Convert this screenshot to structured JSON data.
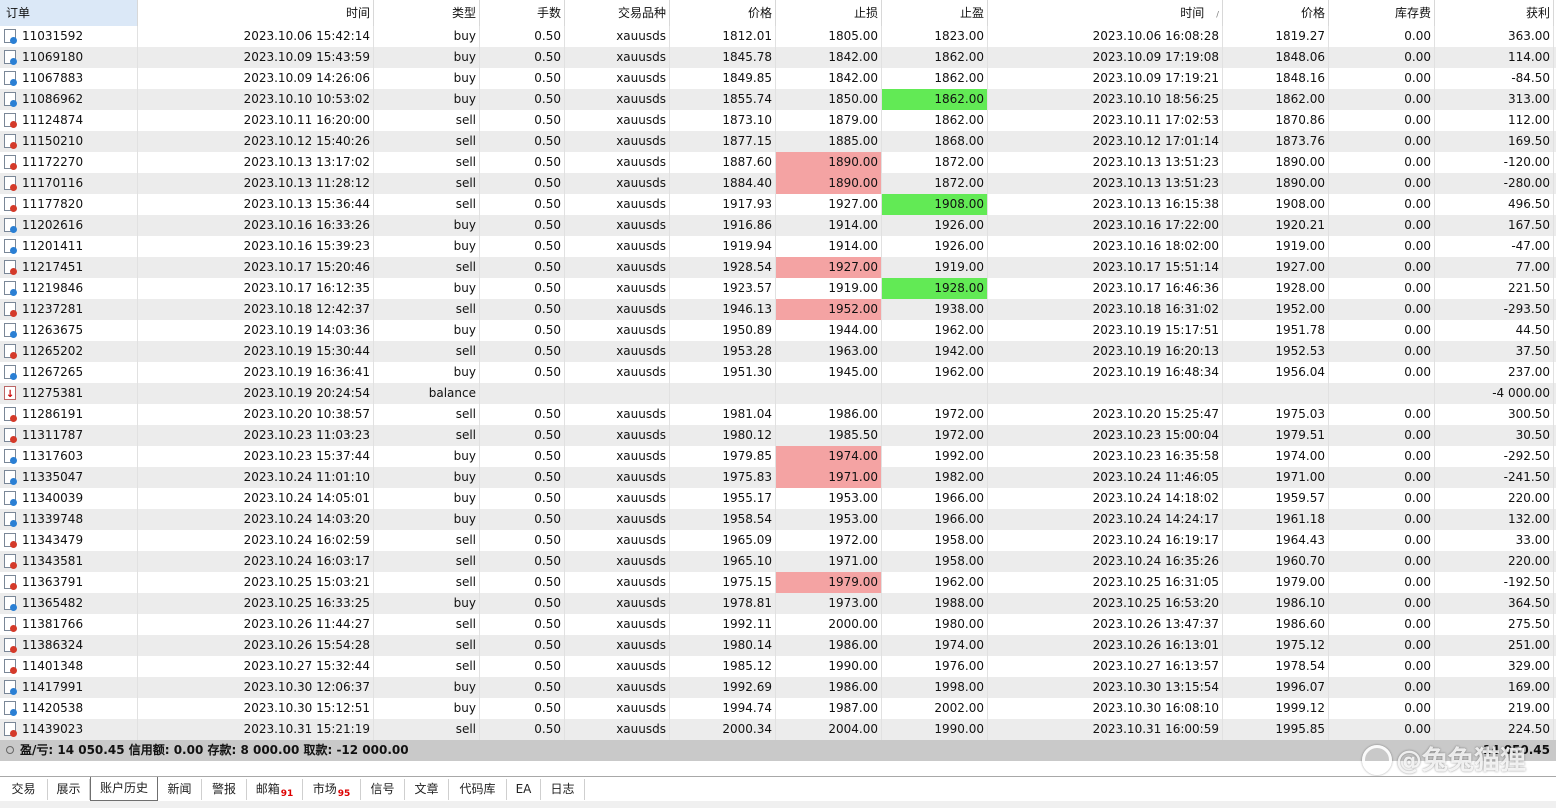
{
  "columns": [
    "订单",
    "时间",
    "类型",
    "手数",
    "交易品种",
    "价格",
    "止损",
    "止盈",
    "时间",
    "价格",
    "库存费",
    "获利"
  ],
  "sort_indicator": "/",
  "colors": {
    "sl_hit": "#f4a3a3",
    "tp_hit": "#62ea55",
    "buy_icon": "#2a7fd4",
    "sell_icon": "#d43a2a"
  },
  "rows": [
    {
      "order": "11031592",
      "open_time": "2023.10.06 15:42:14",
      "type": "buy",
      "lots": "0.50",
      "symbol": "xauusds",
      "price": "1812.01",
      "sl": "1805.00",
      "tp": "1823.00",
      "close_time": "2023.10.06 16:08:28",
      "close_price": "1819.27",
      "swap": "0.00",
      "profit": "363.00",
      "hl": ""
    },
    {
      "order": "11069180",
      "open_time": "2023.10.09 15:43:59",
      "type": "buy",
      "lots": "0.50",
      "symbol": "xauusds",
      "price": "1845.78",
      "sl": "1842.00",
      "tp": "1862.00",
      "close_time": "2023.10.09 17:19:08",
      "close_price": "1848.06",
      "swap": "0.00",
      "profit": "114.00",
      "hl": ""
    },
    {
      "order": "11067883",
      "open_time": "2023.10.09 14:26:06",
      "type": "buy",
      "lots": "0.50",
      "symbol": "xauusds",
      "price": "1849.85",
      "sl": "1842.00",
      "tp": "1862.00",
      "close_time": "2023.10.09 17:19:21",
      "close_price": "1848.16",
      "swap": "0.00",
      "profit": "-84.50",
      "hl": ""
    },
    {
      "order": "11086962",
      "open_time": "2023.10.10 10:53:02",
      "type": "buy",
      "lots": "0.50",
      "symbol": "xauusds",
      "price": "1855.74",
      "sl": "1850.00",
      "tp": "1862.00",
      "close_time": "2023.10.10 18:56:25",
      "close_price": "1862.00",
      "swap": "0.00",
      "profit": "313.00",
      "hl": "tp"
    },
    {
      "order": "11124874",
      "open_time": "2023.10.11 16:20:00",
      "type": "sell",
      "lots": "0.50",
      "symbol": "xauusds",
      "price": "1873.10",
      "sl": "1879.00",
      "tp": "1862.00",
      "close_time": "2023.10.11 17:02:53",
      "close_price": "1870.86",
      "swap": "0.00",
      "profit": "112.00",
      "hl": ""
    },
    {
      "order": "11150210",
      "open_time": "2023.10.12 15:40:26",
      "type": "sell",
      "lots": "0.50",
      "symbol": "xauusds",
      "price": "1877.15",
      "sl": "1885.00",
      "tp": "1868.00",
      "close_time": "2023.10.12 17:01:14",
      "close_price": "1873.76",
      "swap": "0.00",
      "profit": "169.50",
      "hl": ""
    },
    {
      "order": "11172270",
      "open_time": "2023.10.13 13:17:02",
      "type": "sell",
      "lots": "0.50",
      "symbol": "xauusds",
      "price": "1887.60",
      "sl": "1890.00",
      "tp": "1872.00",
      "close_time": "2023.10.13 13:51:23",
      "close_price": "1890.00",
      "swap": "0.00",
      "profit": "-120.00",
      "hl": "sl"
    },
    {
      "order": "11170116",
      "open_time": "2023.10.13 11:28:12",
      "type": "sell",
      "lots": "0.50",
      "symbol": "xauusds",
      "price": "1884.40",
      "sl": "1890.00",
      "tp": "1872.00",
      "close_time": "2023.10.13 13:51:23",
      "close_price": "1890.00",
      "swap": "0.00",
      "profit": "-280.00",
      "hl": "sl"
    },
    {
      "order": "11177820",
      "open_time": "2023.10.13 15:36:44",
      "type": "sell",
      "lots": "0.50",
      "symbol": "xauusds",
      "price": "1917.93",
      "sl": "1927.00",
      "tp": "1908.00",
      "close_time": "2023.10.13 16:15:38",
      "close_price": "1908.00",
      "swap": "0.00",
      "profit": "496.50",
      "hl": "tp"
    },
    {
      "order": "11202616",
      "open_time": "2023.10.16 16:33:26",
      "type": "buy",
      "lots": "0.50",
      "symbol": "xauusds",
      "price": "1916.86",
      "sl": "1914.00",
      "tp": "1926.00",
      "close_time": "2023.10.16 17:22:00",
      "close_price": "1920.21",
      "swap": "0.00",
      "profit": "167.50",
      "hl": ""
    },
    {
      "order": "11201411",
      "open_time": "2023.10.16 15:39:23",
      "type": "buy",
      "lots": "0.50",
      "symbol": "xauusds",
      "price": "1919.94",
      "sl": "1914.00",
      "tp": "1926.00",
      "close_time": "2023.10.16 18:02:00",
      "close_price": "1919.00",
      "swap": "0.00",
      "profit": "-47.00",
      "hl": ""
    },
    {
      "order": "11217451",
      "open_time": "2023.10.17 15:20:46",
      "type": "sell",
      "lots": "0.50",
      "symbol": "xauusds",
      "price": "1928.54",
      "sl": "1927.00",
      "tp": "1919.00",
      "close_time": "2023.10.17 15:51:14",
      "close_price": "1927.00",
      "swap": "0.00",
      "profit": "77.00",
      "hl": "sl"
    },
    {
      "order": "11219846",
      "open_time": "2023.10.17 16:12:35",
      "type": "buy",
      "lots": "0.50",
      "symbol": "xauusds",
      "price": "1923.57",
      "sl": "1919.00",
      "tp": "1928.00",
      "close_time": "2023.10.17 16:46:36",
      "close_price": "1928.00",
      "swap": "0.00",
      "profit": "221.50",
      "hl": "tp"
    },
    {
      "order": "11237281",
      "open_time": "2023.10.18 12:42:37",
      "type": "sell",
      "lots": "0.50",
      "symbol": "xauusds",
      "price": "1946.13",
      "sl": "1952.00",
      "tp": "1938.00",
      "close_time": "2023.10.18 16:31:02",
      "close_price": "1952.00",
      "swap": "0.00",
      "profit": "-293.50",
      "hl": "sl"
    },
    {
      "order": "11263675",
      "open_time": "2023.10.19 14:03:36",
      "type": "buy",
      "lots": "0.50",
      "symbol": "xauusds",
      "price": "1950.89",
      "sl": "1944.00",
      "tp": "1962.00",
      "close_time": "2023.10.19 15:17:51",
      "close_price": "1951.78",
      "swap": "0.00",
      "profit": "44.50",
      "hl": ""
    },
    {
      "order": "11265202",
      "open_time": "2023.10.19 15:30:44",
      "type": "sell",
      "lots": "0.50",
      "symbol": "xauusds",
      "price": "1953.28",
      "sl": "1963.00",
      "tp": "1942.00",
      "close_time": "2023.10.19 16:20:13",
      "close_price": "1952.53",
      "swap": "0.00",
      "profit": "37.50",
      "hl": ""
    },
    {
      "order": "11267265",
      "open_time": "2023.10.19 16:36:41",
      "type": "buy",
      "lots": "0.50",
      "symbol": "xauusds",
      "price": "1951.30",
      "sl": "1945.00",
      "tp": "1962.00",
      "close_time": "2023.10.19 16:48:34",
      "close_price": "1956.04",
      "swap": "0.00",
      "profit": "237.00",
      "hl": ""
    },
    {
      "order": "11275381",
      "open_time": "2023.10.19 20:24:54",
      "type": "balance",
      "lots": "",
      "symbol": "",
      "price": "",
      "sl": "",
      "tp": "",
      "close_time": "",
      "close_price": "",
      "swap": "",
      "profit": "-4 000.00",
      "hl": ""
    },
    {
      "order": "11286191",
      "open_time": "2023.10.20 10:38:57",
      "type": "sell",
      "lots": "0.50",
      "symbol": "xauusds",
      "price": "1981.04",
      "sl": "1986.00",
      "tp": "1972.00",
      "close_time": "2023.10.20 15:25:47",
      "close_price": "1975.03",
      "swap": "0.00",
      "profit": "300.50",
      "hl": ""
    },
    {
      "order": "11311787",
      "open_time": "2023.10.23 11:03:23",
      "type": "sell",
      "lots": "0.50",
      "symbol": "xauusds",
      "price": "1980.12",
      "sl": "1985.50",
      "tp": "1972.00",
      "close_time": "2023.10.23 15:00:04",
      "close_price": "1979.51",
      "swap": "0.00",
      "profit": "30.50",
      "hl": ""
    },
    {
      "order": "11317603",
      "open_time": "2023.10.23 15:37:44",
      "type": "buy",
      "lots": "0.50",
      "symbol": "xauusds",
      "price": "1979.85",
      "sl": "1974.00",
      "tp": "1992.00",
      "close_time": "2023.10.23 16:35:58",
      "close_price": "1974.00",
      "swap": "0.00",
      "profit": "-292.50",
      "hl": "sl"
    },
    {
      "order": "11335047",
      "open_time": "2023.10.24 11:01:10",
      "type": "buy",
      "lots": "0.50",
      "symbol": "xauusds",
      "price": "1975.83",
      "sl": "1971.00",
      "tp": "1982.00",
      "close_time": "2023.10.24 11:46:05",
      "close_price": "1971.00",
      "swap": "0.00",
      "profit": "-241.50",
      "hl": "sl"
    },
    {
      "order": "11340039",
      "open_time": "2023.10.24 14:05:01",
      "type": "buy",
      "lots": "0.50",
      "symbol": "xauusds",
      "price": "1955.17",
      "sl": "1953.00",
      "tp": "1966.00",
      "close_time": "2023.10.24 14:18:02",
      "close_price": "1959.57",
      "swap": "0.00",
      "profit": "220.00",
      "hl": ""
    },
    {
      "order": "11339748",
      "open_time": "2023.10.24 14:03:20",
      "type": "buy",
      "lots": "0.50",
      "symbol": "xauusds",
      "price": "1958.54",
      "sl": "1953.00",
      "tp": "1966.00",
      "close_time": "2023.10.24 14:24:17",
      "close_price": "1961.18",
      "swap": "0.00",
      "profit": "132.00",
      "hl": ""
    },
    {
      "order": "11343479",
      "open_time": "2023.10.24 16:02:59",
      "type": "sell",
      "lots": "0.50",
      "symbol": "xauusds",
      "price": "1965.09",
      "sl": "1972.00",
      "tp": "1958.00",
      "close_time": "2023.10.24 16:19:17",
      "close_price": "1964.43",
      "swap": "0.00",
      "profit": "33.00",
      "hl": ""
    },
    {
      "order": "11343581",
      "open_time": "2023.10.24 16:03:17",
      "type": "sell",
      "lots": "0.50",
      "symbol": "xauusds",
      "price": "1965.10",
      "sl": "1971.00",
      "tp": "1958.00",
      "close_time": "2023.10.24 16:35:26",
      "close_price": "1960.70",
      "swap": "0.00",
      "profit": "220.00",
      "hl": ""
    },
    {
      "order": "11363791",
      "open_time": "2023.10.25 15:03:21",
      "type": "sell",
      "lots": "0.50",
      "symbol": "xauusds",
      "price": "1975.15",
      "sl": "1979.00",
      "tp": "1962.00",
      "close_time": "2023.10.25 16:31:05",
      "close_price": "1979.00",
      "swap": "0.00",
      "profit": "-192.50",
      "hl": "sl"
    },
    {
      "order": "11365482",
      "open_time": "2023.10.25 16:33:25",
      "type": "buy",
      "lots": "0.50",
      "symbol": "xauusds",
      "price": "1978.81",
      "sl": "1973.00",
      "tp": "1988.00",
      "close_time": "2023.10.25 16:53:20",
      "close_price": "1986.10",
      "swap": "0.00",
      "profit": "364.50",
      "hl": ""
    },
    {
      "order": "11381766",
      "open_time": "2023.10.26 11:44:27",
      "type": "sell",
      "lots": "0.50",
      "symbol": "xauusds",
      "price": "1992.11",
      "sl": "2000.00",
      "tp": "1980.00",
      "close_time": "2023.10.26 13:47:37",
      "close_price": "1986.60",
      "swap": "0.00",
      "profit": "275.50",
      "hl": ""
    },
    {
      "order": "11386324",
      "open_time": "2023.10.26 15:54:28",
      "type": "sell",
      "lots": "0.50",
      "symbol": "xauusds",
      "price": "1980.14",
      "sl": "1986.00",
      "tp": "1974.00",
      "close_time": "2023.10.26 16:13:01",
      "close_price": "1975.12",
      "swap": "0.00",
      "profit": "251.00",
      "hl": ""
    },
    {
      "order": "11401348",
      "open_time": "2023.10.27 15:32:44",
      "type": "sell",
      "lots": "0.50",
      "symbol": "xauusds",
      "price": "1985.12",
      "sl": "1990.00",
      "tp": "1976.00",
      "close_time": "2023.10.27 16:13:57",
      "close_price": "1978.54",
      "swap": "0.00",
      "profit": "329.00",
      "hl": ""
    },
    {
      "order": "11417991",
      "open_time": "2023.10.30 12:06:37",
      "type": "buy",
      "lots": "0.50",
      "symbol": "xauusds",
      "price": "1992.69",
      "sl": "1986.00",
      "tp": "1998.00",
      "close_time": "2023.10.30 13:15:54",
      "close_price": "1996.07",
      "swap": "0.00",
      "profit": "169.00",
      "hl": ""
    },
    {
      "order": "11420538",
      "open_time": "2023.10.30 15:12:51",
      "type": "buy",
      "lots": "0.50",
      "symbol": "xauusds",
      "price": "1994.74",
      "sl": "1987.00",
      "tp": "2002.00",
      "close_time": "2023.10.30 16:08:10",
      "close_price": "1999.12",
      "swap": "0.00",
      "profit": "219.00",
      "hl": ""
    },
    {
      "order": "11439023",
      "open_time": "2023.10.31 15:21:19",
      "type": "sell",
      "lots": "0.50",
      "symbol": "xauusds",
      "price": "2000.34",
      "sl": "2004.00",
      "tp": "1990.00",
      "close_time": "2023.10.31 16:00:59",
      "close_price": "1995.85",
      "swap": "0.00",
      "profit": "224.50",
      "hl": ""
    }
  ],
  "summary": {
    "text": "盈/亏: 14 050.45  信用额: 0.00  存款: 8 000.00  取款: -12 000.00",
    "total": "14 050.45"
  },
  "tabs": [
    {
      "label": "交易",
      "badge": "",
      "active": false
    },
    {
      "label": "展示",
      "badge": "",
      "active": false
    },
    {
      "label": "账户历史",
      "badge": "",
      "active": true
    },
    {
      "label": "新闻",
      "badge": "",
      "active": false
    },
    {
      "label": "警报",
      "badge": "",
      "active": false
    },
    {
      "label": "邮箱",
      "badge": "91",
      "active": false
    },
    {
      "label": "市场",
      "badge": "95",
      "active": false
    },
    {
      "label": "信号",
      "badge": "",
      "active": false
    },
    {
      "label": "文章",
      "badge": "",
      "active": false
    },
    {
      "label": "代码库",
      "badge": "",
      "active": false
    },
    {
      "label": "EA",
      "badge": "",
      "active": false
    },
    {
      "label": "日志",
      "badge": "",
      "active": false
    }
  ],
  "watermark": "@兔兔猫狸"
}
